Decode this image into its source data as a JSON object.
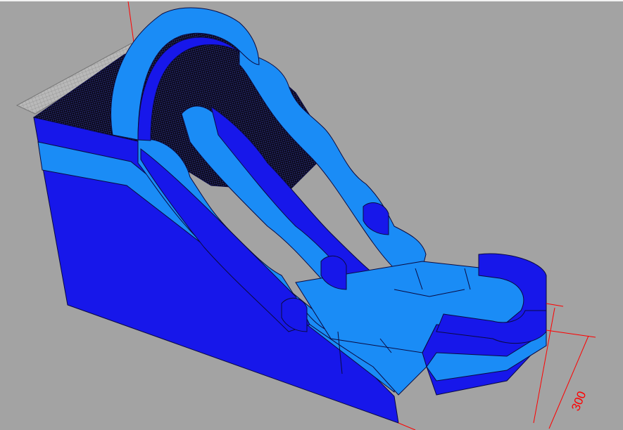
{
  "viewport": {
    "background": "#a3a3a3"
  },
  "model": {
    "name": "",
    "colors": {
      "dark_blue": "#1717ea",
      "light_blue": "#1a8cf6",
      "edge": "#0a0a40",
      "mesh": "#000000",
      "ground_mesh": "#c4c4c4",
      "dimension": "#ff0000"
    }
  },
  "dimension": {
    "value_text": "300"
  }
}
